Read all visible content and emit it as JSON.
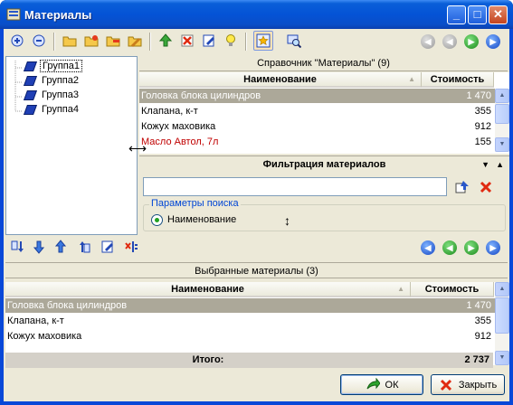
{
  "window": {
    "title": "Материалы",
    "min_label": "_",
    "max_label": "□",
    "close_label": "✕"
  },
  "toolbar_top": {
    "icons": [
      "add-icon",
      "remove-icon",
      "folder-icon",
      "folder-add-icon",
      "folder-remove-icon",
      "folder-edit-icon",
      "up-icon",
      "delete-icon",
      "edit-icon",
      "lightbulb-icon",
      "star-filter-icon",
      "search-icon"
    ],
    "nav": [
      "first-nav-icon",
      "prev-nav-icon",
      "next-nav-icon",
      "last-nav-icon"
    ]
  },
  "tree": {
    "items": [
      "Группа1",
      "Группа2",
      "Группа3",
      "Группа4"
    ]
  },
  "directory": {
    "title": "Справочник \"Материалы\" (9)",
    "columns": {
      "name": "Наименование",
      "cost": "Стоимость"
    },
    "rows": [
      {
        "name": "Головка блока цилиндров",
        "cost": "1 470"
      },
      {
        "name": "Клапана, к-т",
        "cost": "355"
      },
      {
        "name": "Кожух маховика",
        "cost": "912"
      },
      {
        "name": "Масло Автол, 7л",
        "cost": "155"
      }
    ]
  },
  "filter": {
    "title": "Фильтрация материалов",
    "input_value": "",
    "group_title": "Параметры поиска",
    "radio_label": "Наименование"
  },
  "toolbar_bottom": {
    "icons": [
      "move-bottom-icon",
      "move-down-icon",
      "move-up-icon",
      "move-top-icon",
      "edit-icon",
      "clear-icon"
    ]
  },
  "selected": {
    "title": "Выбранные материалы (3)",
    "columns": {
      "name": "Наименование",
      "cost": "Стоимость"
    },
    "rows": [
      {
        "name": "Головка блока цилиндров",
        "cost": "1 470"
      },
      {
        "name": "Клапана, к-т",
        "cost": "355"
      },
      {
        "name": "Кожух маховика",
        "cost": "912"
      }
    ],
    "total_label": "Итого:",
    "total_value": "2 737"
  },
  "buttons": {
    "ok": "ОК",
    "close": "Закрыть"
  },
  "colors": {
    "selection": "#aca899",
    "red_text": "#c00000",
    "accent": "#0046d5"
  }
}
